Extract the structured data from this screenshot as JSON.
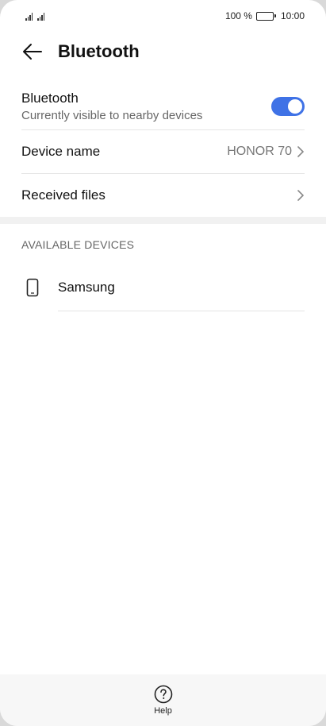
{
  "status_bar": {
    "battery_text": "100 %",
    "time": "10:00"
  },
  "header": {
    "title": "Bluetooth"
  },
  "bluetooth_row": {
    "title": "Bluetooth",
    "subtitle": "Currently visible to nearby devices",
    "enabled": true
  },
  "device_name_row": {
    "title": "Device name",
    "value": "HONOR 70"
  },
  "received_files_row": {
    "title": "Received files"
  },
  "available_devices": {
    "section_label": "AVAILABLE DEVICES",
    "items": [
      {
        "name": "Samsung",
        "icon": "phone-icon"
      }
    ]
  },
  "bottom_bar": {
    "help_label": "Help"
  },
  "colors": {
    "accent": "#3f72e6",
    "text_primary": "#111111",
    "text_secondary": "#666666"
  }
}
